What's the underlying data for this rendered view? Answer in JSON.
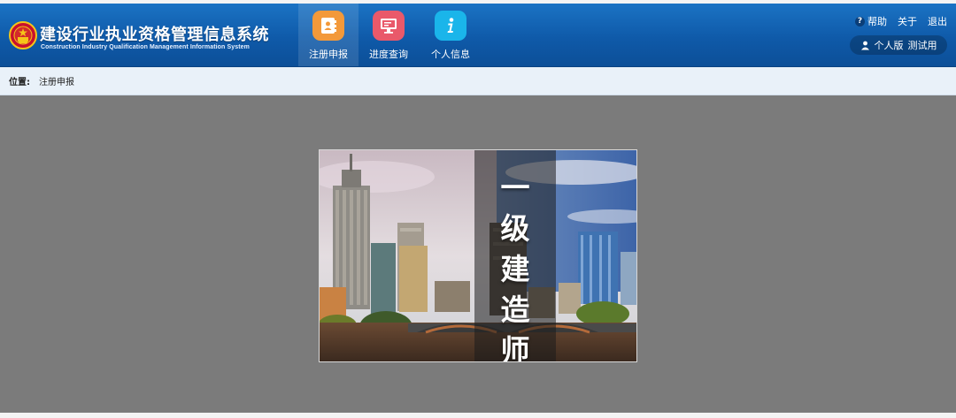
{
  "header": {
    "title_zh": "建设行业执业资格管理信息系统",
    "title_en": "Construction Industry Qualification Management Information System",
    "nav": [
      {
        "label": "注册申报",
        "icon": "contact-book-icon",
        "color": "#f3993a",
        "active": true
      },
      {
        "label": "进度查询",
        "icon": "monitor-icon",
        "color": "#e9596a",
        "active": false
      },
      {
        "label": "个人信息",
        "icon": "info-icon",
        "color": "#1ab5ea",
        "active": false
      }
    ],
    "links": {
      "help": "帮助",
      "about": "关于",
      "logout": "退出"
    },
    "user": {
      "version": "个人版",
      "name": "测试用"
    }
  },
  "breadcrumb": {
    "label": "位置:",
    "current": "注册申报"
  },
  "banner": {
    "title_chars": [
      "一",
      "级",
      "建",
      "造",
      "师"
    ]
  },
  "colors": {
    "header": "#1166b5",
    "breadcrumb_bg": "#e9f1f9",
    "content_bg": "#7b7b7b"
  }
}
